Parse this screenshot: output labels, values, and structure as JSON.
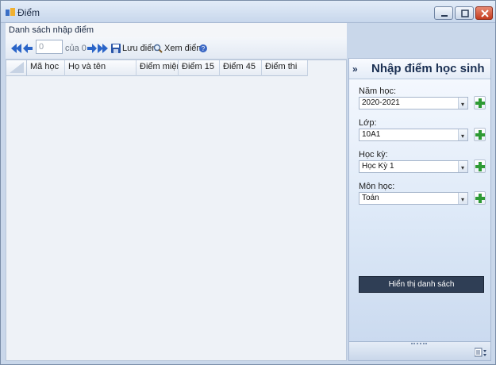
{
  "window": {
    "title": "Điểm"
  },
  "section": {
    "label": "Danh sách nhập điểm"
  },
  "toolbar": {
    "page_value": "0",
    "page_total": "của 0",
    "save_label": "Lưu điểm",
    "view_label": "Xem điểm"
  },
  "grid": {
    "columns": [
      "Mã học",
      "Họ và tên",
      "Điểm miệng",
      "Điểm 15",
      "Điểm 45",
      "Điểm thi"
    ]
  },
  "panel": {
    "title": "Nhập điểm học sinh",
    "fields": [
      {
        "label": "Năm học:",
        "value": "2020-2021"
      },
      {
        "label": "Lớp:",
        "value": "10A1"
      },
      {
        "label": "Học kỳ:",
        "value": "Học Kỳ 1"
      },
      {
        "label": "Môn học:",
        "value": "Toán"
      }
    ],
    "action_label": "Hiển thị danh sách"
  },
  "colors": {
    "accent": "#2f3e55",
    "plus_green": "#2e9a34",
    "nav_blue": "#2a64c8"
  }
}
